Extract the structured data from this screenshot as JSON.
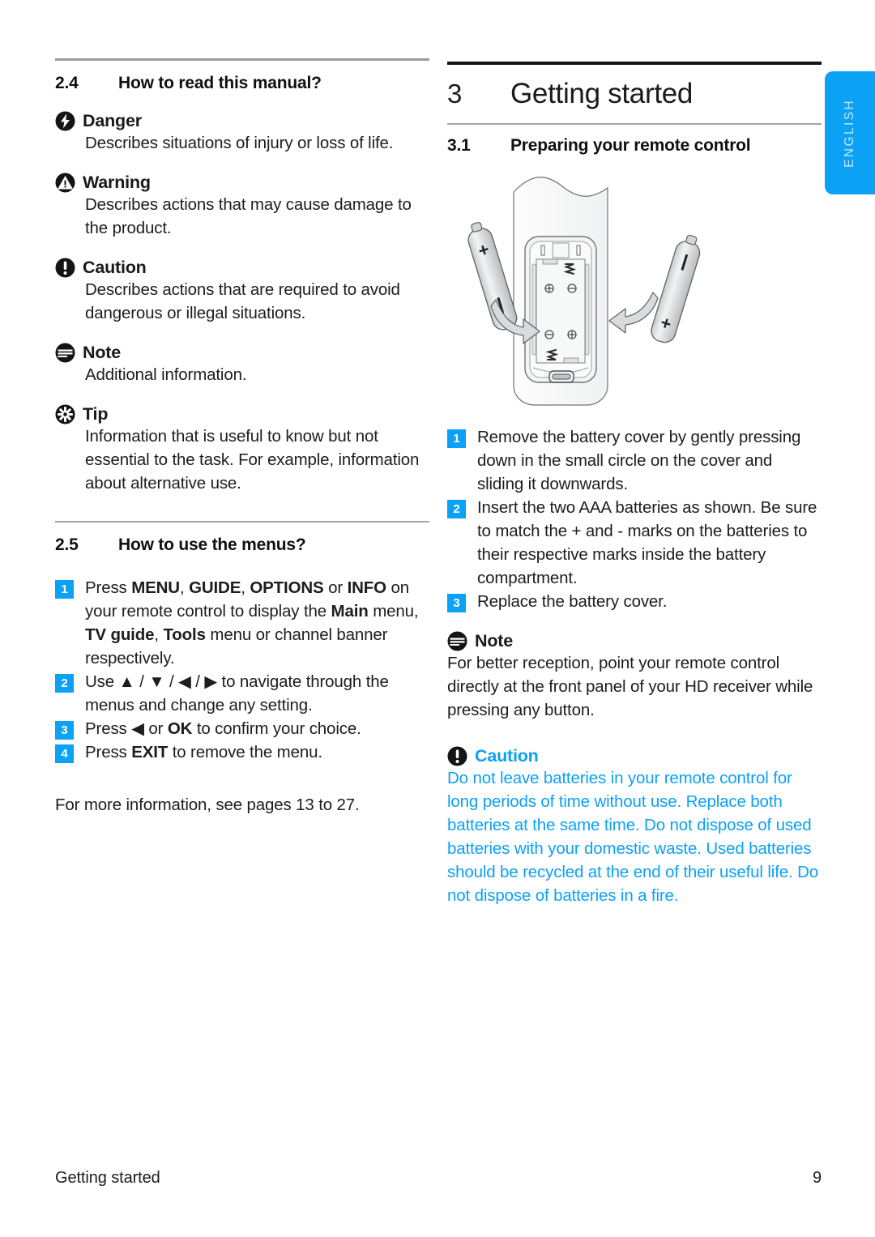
{
  "language_tab": {
    "label": "ENGLISH"
  },
  "left_column": {
    "section_2_4": {
      "number": "2.4",
      "title": "How to read this manual?",
      "notices": [
        {
          "icon": "danger-icon",
          "label": "Danger",
          "text": "Describes situations of injury or loss of life."
        },
        {
          "icon": "warning-icon",
          "label": "Warning",
          "text": "Describes actions that may cause damage to the product."
        },
        {
          "icon": "caution-icon",
          "label": "Caution",
          "text": "Describes actions that are required to avoid dangerous or illegal situations."
        },
        {
          "icon": "note-icon",
          "label": "Note",
          "text": "Additional information."
        },
        {
          "icon": "tip-icon",
          "label": "Tip",
          "text": "Information that is useful to know but not essential to the task. For example, information about alternative use."
        }
      ]
    },
    "section_2_5": {
      "number": "2.5",
      "title": "How to use the menus?",
      "steps": [
        {
          "badge": "1",
          "html": "Press <b>MENU</b>, <b>GUIDE</b>, <b>OPTIONS</b> or <b>INFO</b> on your remote control to display the <b>Main</b> menu, <b>TV guide</b>, <b>Tools</b> menu or channel banner respectively."
        },
        {
          "badge": "2",
          "html": "Use ▲ / ▼ / ◀ / ▶ to navigate through the menus and change any setting."
        },
        {
          "badge": "3",
          "html": "Press ◀ or <b>OK</b> to confirm your choice."
        },
        {
          "badge": "4",
          "html": "Press <b>EXIT</b> to remove the menu."
        }
      ],
      "footnote": "For more information, see pages 13 to 27."
    }
  },
  "right_column": {
    "chapter": {
      "number": "3",
      "title": "Getting started"
    },
    "section_3_1": {
      "number": "3.1",
      "title": "Preparing your remote control"
    },
    "illustration": {
      "name": "remote-control-battery-diagram",
      "battery_left_mark": "+",
      "battery_right_mark": "+",
      "polarity_marks": [
        "⊕",
        "⊖",
        "⊖",
        "⊕"
      ]
    },
    "steps": [
      {
        "badge": "1",
        "html": "Remove the battery cover by gently pressing down in the small circle on the cover and sliding it downwards."
      },
      {
        "badge": "2",
        "html": "Insert the two AAA batteries as shown. Be sure to match the + and - marks on the batteries to their respective marks inside the battery compartment."
      },
      {
        "badge": "3",
        "html": "Replace the battery cover."
      }
    ],
    "note": {
      "icon": "note-icon",
      "label": "Note",
      "text": "For better reception, point your remote control directly at the front panel of your HD receiver while pressing any button."
    },
    "caution": {
      "icon": "caution-icon",
      "label": "Caution",
      "text": "Do not leave batteries in your remote control for long periods of time without use. Replace both batteries at the same time. Do not dispose of used batteries with your domestic waste. Used batteries should be recycled at the end of their useful life. Do not dispose of batteries in a fire."
    }
  },
  "footer": {
    "left": "Getting started",
    "page_number": "9"
  },
  "colors": {
    "accent_blue": "#0BA1F5",
    "caution_text_blue": "#0BA1F5",
    "body_text": "#1d1d1d"
  }
}
